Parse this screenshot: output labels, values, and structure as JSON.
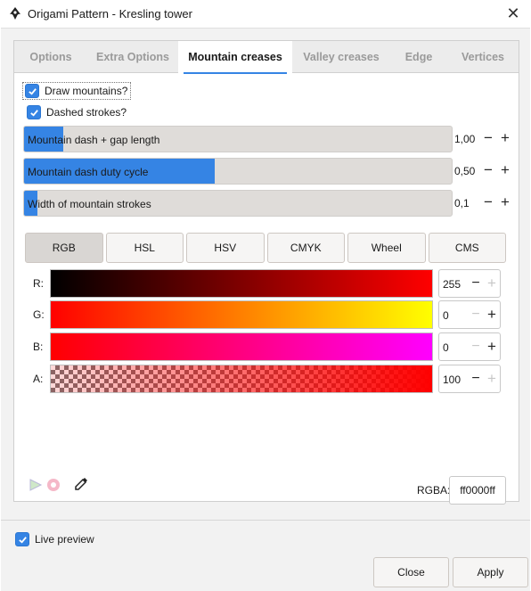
{
  "window": {
    "title": "Origami Pattern - Kresling tower"
  },
  "tabs": [
    {
      "label": "Options"
    },
    {
      "label": "Extra Options"
    },
    {
      "label": "Mountain creases"
    },
    {
      "label": "Valley creases"
    },
    {
      "label": "Edge"
    },
    {
      "label": "Vertices"
    }
  ],
  "active_tab": "Mountain creases",
  "checks": {
    "draw_mountains": {
      "label": "Draw mountains?",
      "checked": true
    },
    "dashed_strokes": {
      "label": "Dashed strokes?",
      "checked": true
    }
  },
  "sliders": [
    {
      "label": "Mountain dash + gap length",
      "value": "1,00",
      "fill_fraction": 0.09
    },
    {
      "label": "Mountain dash duty cycle",
      "value": "0,50",
      "fill_fraction": 0.44
    },
    {
      "label": "Width of mountain strokes",
      "value": "0,1",
      "fill_fraction": 0.03
    }
  ],
  "color_modes": [
    "RGB",
    "HSL",
    "HSV",
    "CMYK",
    "Wheel",
    "CMS"
  ],
  "active_color_mode": "RGB",
  "channels": [
    {
      "label": "R:",
      "value": "255"
    },
    {
      "label": "G:",
      "value": "0"
    },
    {
      "label": "B:",
      "value": "0"
    },
    {
      "label": "A:",
      "value": "100"
    }
  ],
  "rgba": {
    "label": "RGBA:",
    "value": "ff0000ff"
  },
  "live_preview": {
    "label": "Live preview",
    "checked": true
  },
  "buttons": {
    "close": "Close",
    "apply": "Apply"
  },
  "colors": {
    "accent": "#3584e4",
    "selected": "#ff0000"
  }
}
